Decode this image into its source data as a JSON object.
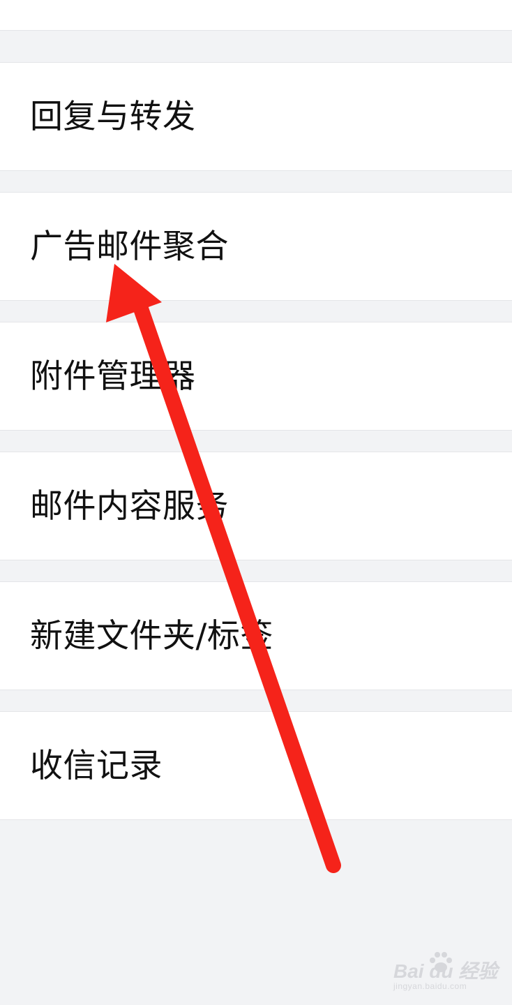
{
  "settings_list": {
    "items": [
      {
        "label": "回复与转发"
      },
      {
        "label": "广告邮件聚合"
      },
      {
        "label": "附件管理器"
      },
      {
        "label": "邮件内容服务"
      },
      {
        "label": "新建文件夹/标签"
      },
      {
        "label": "收信记录"
      }
    ]
  },
  "annotation": {
    "arrow_color": "#f5231a",
    "points_to": "广告邮件聚合"
  },
  "watermark": {
    "brand": "Bai du 经验",
    "url": "jingyan.baidu.com"
  },
  "colors": {
    "background": "#f2f3f5",
    "row_background": "#ffffff",
    "text": "#111111",
    "divider": "#e4e5e8"
  }
}
